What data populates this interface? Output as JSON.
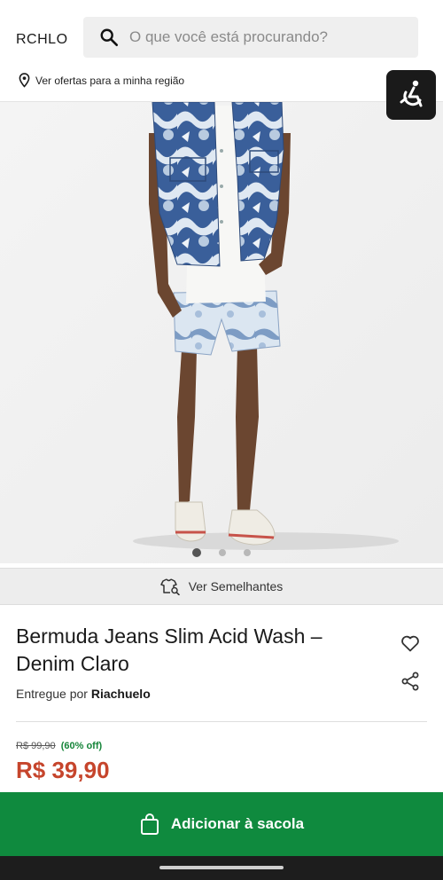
{
  "header": {
    "logo": "RCHLO",
    "search_placeholder": "O que você está procurando?",
    "region_text": "Ver ofertas para a minha região"
  },
  "gallery": {
    "image_alt": "Modelo vestindo bermuda jeans acid wash e colete jeans",
    "slide_count": 3,
    "active_slide": 1
  },
  "similar": {
    "label": "Ver Semelhantes"
  },
  "product": {
    "title": "Bermuda Jeans Slim Acid Wash – Denim Claro",
    "delivery_prefix": "Entregue por",
    "seller": "Riachuelo",
    "old_price": "R$ 99,90",
    "discount": "(60% off)",
    "price": "R$ 39,90"
  },
  "cta": {
    "add_to_bag": "Adicionar à sacola"
  },
  "colors": {
    "primary_green": "#0f8a3e",
    "price_red": "#c6452c",
    "discount_green": "#16853a"
  },
  "icons": [
    "search-icon",
    "location-pin-icon",
    "accessibility-icon",
    "similar-search-icon",
    "heart-icon",
    "share-icon",
    "shopping-bag-icon"
  ]
}
